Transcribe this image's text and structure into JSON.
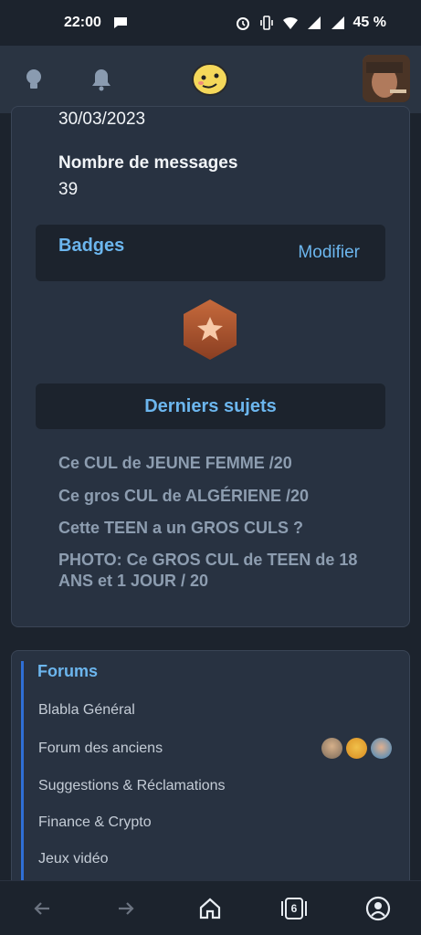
{
  "status_bar": {
    "time": "22:00",
    "battery": "45 %"
  },
  "profile": {
    "date": "30/03/2023",
    "messages_label": "Nombre de messages",
    "messages_count": "39"
  },
  "badges": {
    "title": "Badges",
    "edit_label": "Modifier"
  },
  "latest_subjects": {
    "title": "Derniers sujets",
    "items": [
      "Ce CUL de JEUNE FEMME /20",
      "Ce gros CUL de ALGÉRIENE /20",
      "Cette TEEN a un GROS CULS ?",
      "PHOTO: Ce GROS CUL de TEEN de 18 ANS et 1 JOUR / 20"
    ]
  },
  "forums": {
    "title": "Forums",
    "items": [
      "Blabla Général",
      "Forum des anciens",
      "Suggestions & Réclamations",
      "Finance & Crypto",
      "Jeux vidéo"
    ]
  },
  "tabs_count": "6",
  "colors": {
    "accent": "#6cb6ee",
    "background": "#1c232d",
    "card": "#283241",
    "forum_bar": "#2f6fd6"
  }
}
